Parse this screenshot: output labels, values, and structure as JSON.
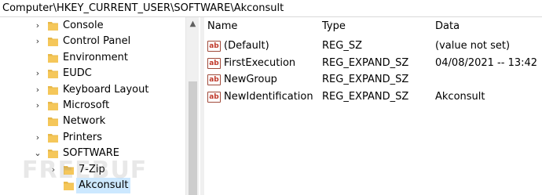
{
  "address_bar": {
    "path": "Computer\\HKEY_CURRENT_USER\\SOFTWARE\\Akconsult"
  },
  "tree": {
    "items": [
      {
        "label": "Console",
        "expander": "›"
      },
      {
        "label": "Control Panel",
        "expander": "›"
      },
      {
        "label": "Environment",
        "expander": ""
      },
      {
        "label": "EUDC",
        "expander": "›"
      },
      {
        "label": "Keyboard Layout",
        "expander": "›"
      },
      {
        "label": "Microsoft",
        "expander": "›"
      },
      {
        "label": "Network",
        "expander": ""
      },
      {
        "label": "Printers",
        "expander": "›"
      },
      {
        "label": "SOFTWARE",
        "expander": "⌄"
      },
      {
        "label": "7-Zip",
        "expander": "›"
      },
      {
        "label": "Akconsult",
        "expander": ""
      }
    ],
    "folder_color": "#e8b94a"
  },
  "values_header": {
    "name": "Name",
    "type": "Type",
    "data": "Data"
  },
  "values": [
    {
      "icon_text": "ab",
      "name": "(Default)",
      "type": "REG_SZ",
      "data": "(value not set)"
    },
    {
      "icon_text": "ab",
      "name": "FirstExecution",
      "type": "REG_EXPAND_SZ",
      "data": "04/08/2021 -- 13:42"
    },
    {
      "icon_text": "ab",
      "name": "NewGroup",
      "type": "REG_EXPAND_SZ",
      "data": ""
    },
    {
      "icon_text": "ab",
      "name": "NewIdentification",
      "type": "REG_EXPAND_SZ",
      "data": "Akconsult"
    }
  ],
  "watermark": "FREEBUF",
  "selection_color": "#cce8ff"
}
